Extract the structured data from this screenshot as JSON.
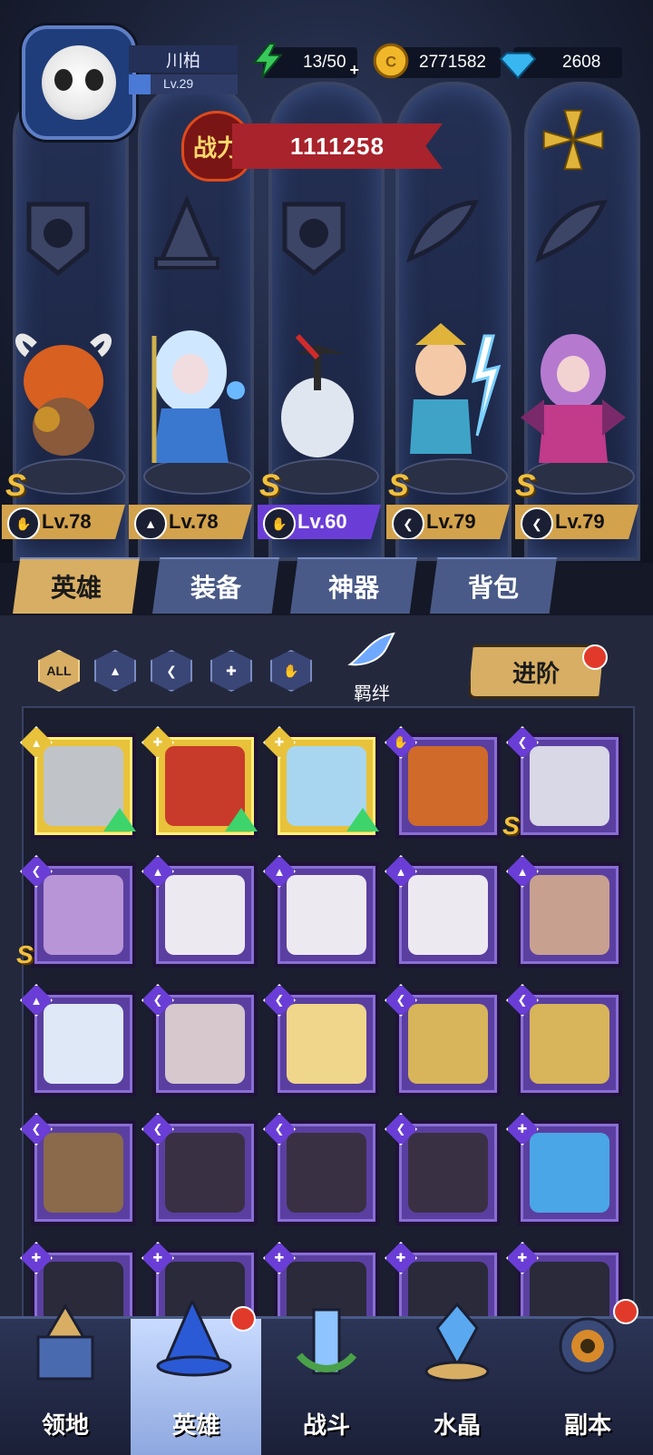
{
  "player": {
    "name": "川柏",
    "level": "Lv.29",
    "xp_fraction": 0.2
  },
  "resources": {
    "energy": "13/50",
    "gold": "2771582",
    "diamonds": "2608"
  },
  "power": {
    "label": "战力",
    "value": "1111258"
  },
  "lineup": [
    {
      "class_icon": "claw-emblem-icon",
      "level": "Lv.78",
      "rank": "S",
      "badge": "gold"
    },
    {
      "class_icon": "wizard-hat-icon",
      "level": "Lv.78",
      "rank": "",
      "badge": "gold"
    },
    {
      "class_icon": "claw-emblem-icon",
      "level": "Lv.60",
      "rank": "S",
      "badge": "purple"
    },
    {
      "class_icon": "wing-icon",
      "level": "Lv.79",
      "rank": "S",
      "badge": "gold"
    },
    {
      "class_icon": "wing-icon",
      "level": "Lv.79",
      "rank": "S",
      "badge": "gold"
    }
  ],
  "tabs": [
    "英雄",
    "装备",
    "神器",
    "背包"
  ],
  "filters": {
    "all": "ALL"
  },
  "bond_label": "羁绊",
  "advance_label": "进阶",
  "nav": [
    "领地",
    "英雄",
    "战斗",
    "水晶",
    "副本"
  ],
  "colors": {
    "gold": "#d7ae63",
    "purple": "#6a3ed6",
    "accent_red": "#a8232c"
  }
}
